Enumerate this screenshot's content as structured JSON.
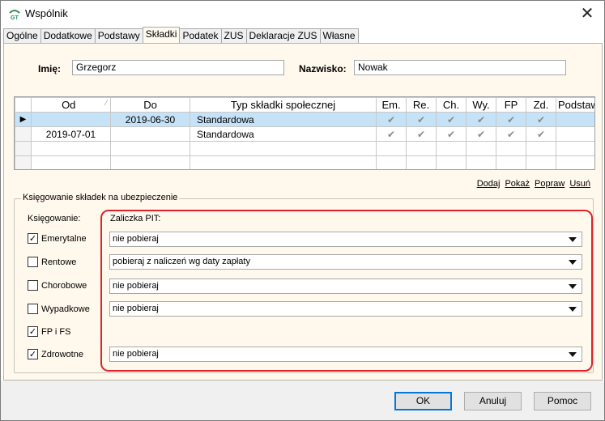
{
  "window": {
    "title": "Wspólnik",
    "close_glyph": "✕",
    "app_icon": "gt-logo-icon"
  },
  "tabs": [
    {
      "label": "Ogólne"
    },
    {
      "label": "Dodatkowe"
    },
    {
      "label": "Podstawy"
    },
    {
      "label": "Składki",
      "active": true
    },
    {
      "label": "Podatek"
    },
    {
      "label": "ZUS"
    },
    {
      "label": "Deklaracje ZUS"
    },
    {
      "label": "Własne"
    }
  ],
  "person": {
    "first_name_label": "Imię:",
    "first_name": "Grzegorz",
    "last_name_label": "Nazwisko:",
    "last_name": "Nowak"
  },
  "grid": {
    "headers": [
      "Od",
      "Do",
      "Typ składki społecznej",
      "Em.",
      "Re.",
      "Ch.",
      "Wy.",
      "FP",
      "Zd.",
      "Podstawa skł"
    ],
    "rows": [
      {
        "selected": true,
        "indicator": "▶",
        "od": "",
        "do": "2019-06-30",
        "typ": "Standardowa",
        "checks": [
          "✔",
          "✔",
          "✔",
          "✔",
          "✔",
          "✔"
        ]
      },
      {
        "selected": false,
        "indicator": "",
        "od": "2019-07-01",
        "do": "",
        "typ": "Standardowa",
        "checks": [
          "✔",
          "✔",
          "✔",
          "✔",
          "✔",
          "✔"
        ]
      }
    ]
  },
  "links": {
    "add": "Dodaj",
    "show": "Pokaż",
    "edit": "Popraw",
    "delete": "Usuń"
  },
  "booking": {
    "group_title": "Księgowanie składek na ubezpieczenie",
    "booking_label": "Księgowanie:",
    "pit_label": "Zaliczka PIT:",
    "items": [
      {
        "label": "Emerytalne",
        "checked": true,
        "pit": "nie pobieraj"
      },
      {
        "label": "Rentowe",
        "checked": false,
        "pit": "pobieraj z naliczeń wg daty zapłaty"
      },
      {
        "label": "Chorobowe",
        "checked": false,
        "pit": "nie pobieraj"
      },
      {
        "label": "Wypadkowe",
        "checked": false,
        "pit": "nie pobieraj"
      },
      {
        "label": "FP i FS",
        "checked": true,
        "pit": null
      },
      {
        "label": "Zdrowotne",
        "checked": true,
        "pit": "nie pobieraj"
      }
    ]
  },
  "buttons": {
    "ok": "OK",
    "cancel": "Anuluj",
    "help": "Pomoc"
  },
  "colors": {
    "highlight": "#e0232a",
    "selected_row": "#c6e2f7",
    "panel_bg": "#fef8ed"
  }
}
